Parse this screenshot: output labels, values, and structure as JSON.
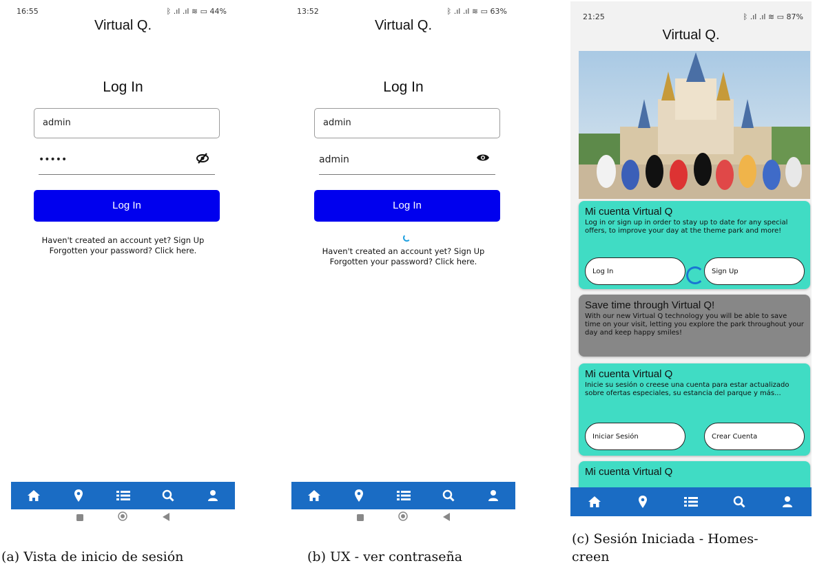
{
  "app_title": "Virtual Q.",
  "screen_a": {
    "status": {
      "time": "16:55",
      "icons": "ᛒ .ıl .ıl ≋ ▭ 44%"
    },
    "heading": "Log In",
    "username": "admin",
    "password_masked": "•••••",
    "eye_icon": "eye-slash-icon",
    "login_button": "Log In",
    "signup_link": "Haven't created an account yet? Sign Up",
    "forgot_link": "Forgotten your password? Click here."
  },
  "screen_b": {
    "status": {
      "time": "13:52",
      "icons": "ᛒ .ıl .ıl ≋ ▭ 63%"
    },
    "heading": "Log In",
    "username": "admin",
    "password_visible": "admin",
    "eye_icon": "eye-icon",
    "login_button": "Log In",
    "signup_link": "Haven't created an account yet? Sign Up",
    "forgot_link": "Forgotten your password? Click here."
  },
  "screen_c": {
    "status": {
      "time": "21:25",
      "icons": "ᛒ .ıl .ıl ≋ ▭ 87%"
    },
    "cards": [
      {
        "title": "Mi cuenta Virtual Q",
        "body": "Log in or sign up in order to stay up to date for any special offers, to improve your day at the theme park and more!",
        "left_button": "Log In",
        "right_button": "Sign Up"
      },
      {
        "title": "Save time through Virtual Q!",
        "body": "With our new Virtual Q technology you will be able to save time on your visit, letting you explore the park throughout your day and keep happy smiles!"
      },
      {
        "title": "Mi cuenta Virtual Q",
        "body": "Inicie su sesión o creese una cuenta para estar actualizado sobre ofertas especiales, su estancia del parque y más...",
        "left_button": "Iniciar Sesión",
        "right_button": "Crear Cuenta"
      },
      {
        "title": "Mi cuenta Virtual Q"
      }
    ]
  },
  "nav_icons": [
    "home-icon",
    "map-marker-icon",
    "list-icon",
    "search-icon",
    "user-icon"
  ],
  "colors": {
    "nav_blue": "#1a6cc4",
    "login_blue": "#0000ee",
    "teal": "#40dcc4",
    "gray_card": "#878787"
  },
  "captions": {
    "a": "(a) Vista de inicio de sesión",
    "b": "(b) UX - ver contraseña",
    "c_line1": "(c) Sesión Iniciada - Homes-",
    "c_line2": "creen"
  }
}
